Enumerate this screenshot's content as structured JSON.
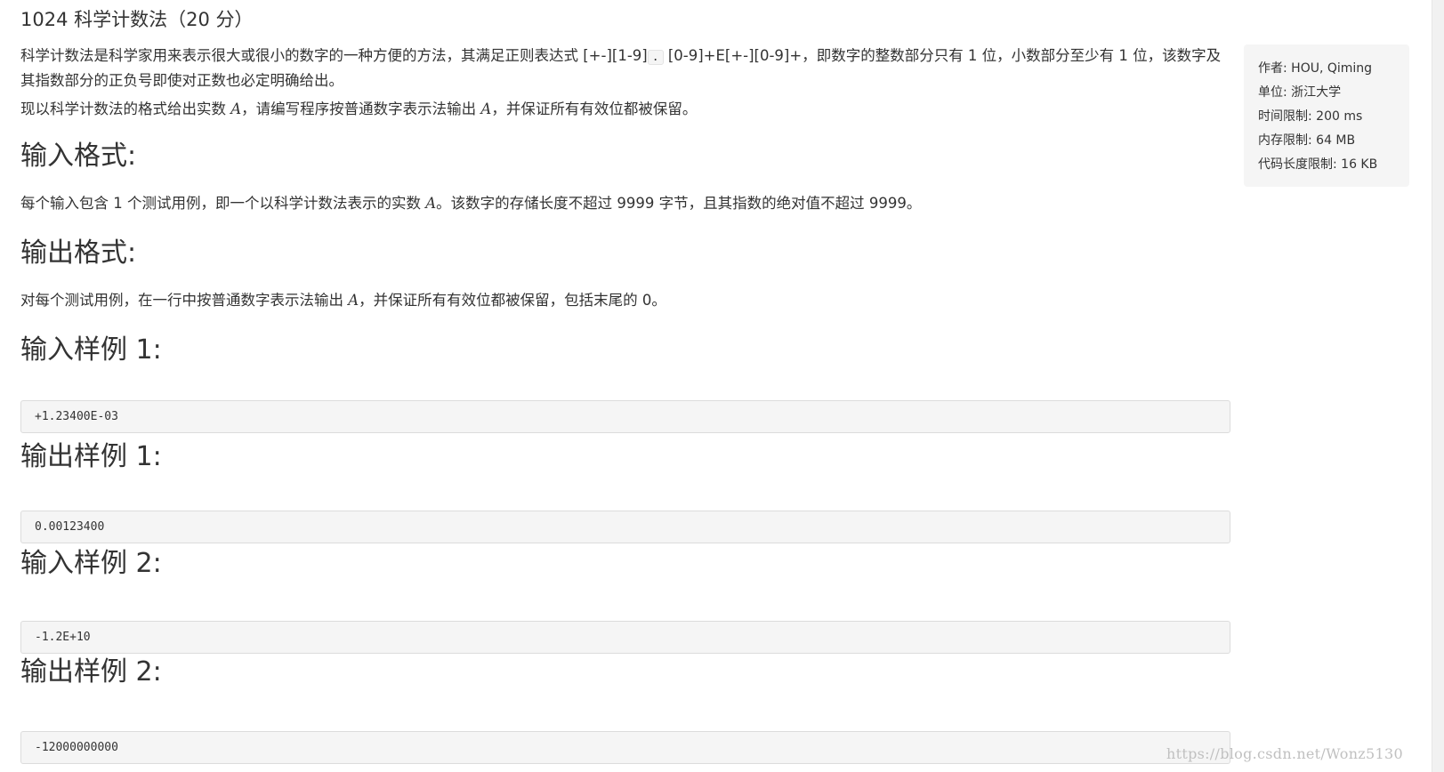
{
  "title": "1024 科学计数法（20 分）",
  "description": {
    "p1_part1": "科学计数法是科学家用来表示很大或很小的数字的一种方便的方法，其满足正则表达式 [+-][1-9]",
    "p1_code": ".",
    "p1_part2": "[0-9]+E[+-][0-9]+，即数字的整数部分只有 1 位，小数部分至少有 1 位，该数字及其指数部分的正负号即使对正数也必定明确给出。",
    "p2_part1": "现以科学计数法的格式给出实数 ",
    "p2_var1": "A",
    "p2_part2": "，请编写程序按普通数字表示法输出 ",
    "p2_var2": "A",
    "p2_part3": "，并保证所有有效位都被保留。"
  },
  "input_format": {
    "heading": "输入格式:",
    "text_part1": "每个输入包含 1 个测试用例，即一个以科学计数法表示的实数 ",
    "text_var": "A",
    "text_part2": "。该数字的存储长度不超过 9999 字节，且其指数的绝对值不超过 9999。"
  },
  "output_format": {
    "heading": "输出格式:",
    "text_part1": "对每个测试用例，在一行中按普通数字表示法输出 ",
    "text_var": "A",
    "text_part2": "，并保证所有有效位都被保留，包括末尾的 0。"
  },
  "samples": {
    "input1_heading": "输入样例 1:",
    "input1": "+1.23400E-03",
    "output1_heading": "输出样例 1:",
    "output1": "0.00123400",
    "input2_heading": "输入样例 2:",
    "input2": "-1.2E+10",
    "output2_heading": "输出样例 2:",
    "output2": "-12000000000"
  },
  "info": {
    "author": "作者: HOU, Qiming",
    "unit": "单位: 浙江大学",
    "time_limit": "时间限制: 200 ms",
    "memory_limit": "内存限制: 64 MB",
    "code_limit": "代码长度限制: 16 KB"
  },
  "watermark": "https://blog.csdn.net/Wonz5130"
}
